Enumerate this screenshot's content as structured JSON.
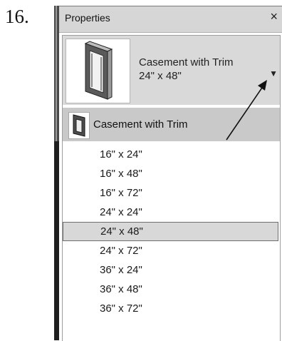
{
  "step": {
    "number": "16."
  },
  "panel": {
    "title": "Properties",
    "close_glyph": "×",
    "close_icon": "close-icon"
  },
  "type_selector": {
    "name": "Casement with Trim",
    "size": "24\" x 48\"",
    "preview_icon": "casement-window-icon",
    "arrow_icon": "dropdown-arrow-icon"
  },
  "dropdown": {
    "family": {
      "label": "Casement with Trim",
      "icon": "window-family-icon"
    },
    "options": [
      {
        "label": "16\" x 24\"",
        "selected": false
      },
      {
        "label": "16\" x 48\"",
        "selected": false
      },
      {
        "label": "16\" x 72\"",
        "selected": false
      },
      {
        "label": "24\" x 24\"",
        "selected": false
      },
      {
        "label": "24\" x 48\"",
        "selected": true
      },
      {
        "label": "24\" x 72\"",
        "selected": false
      },
      {
        "label": "36\" x 24\"",
        "selected": false
      },
      {
        "label": "36\" x 48\"",
        "selected": false
      },
      {
        "label": "36\" x 72\"",
        "selected": false
      }
    ]
  },
  "colors": {
    "titlebar": "#d6d6d6",
    "selector": "#d9d9d9",
    "family_row": "#c9c9c9",
    "selected_option": "#d8d8d8"
  }
}
